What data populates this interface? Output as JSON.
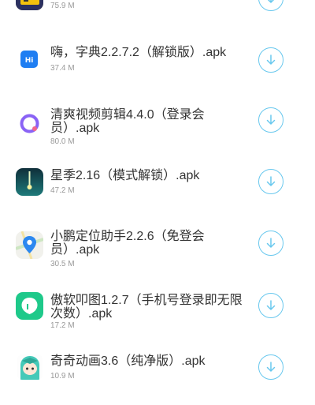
{
  "accent": "#69c8ee",
  "files": [
    {
      "name": "",
      "size": "75.9 M",
      "icon": "game-icon"
    },
    {
      "name": "嗨，字典2.2.7.2（解锁版）.apk",
      "size": "37.4 M",
      "icon": "dictionary-app-icon"
    },
    {
      "name": "清爽视频剪辑4.4.0（登录会员）.apk",
      "size": "80.0 M",
      "icon": "video-editor-app-icon"
    },
    {
      "name": "星季2.16（模式解锁）.apk",
      "size": "47.2 M",
      "icon": "starry-app-icon"
    },
    {
      "name": "小鹏定位助手2.2.6（免登会员）.apk",
      "size": "30.5 M",
      "icon": "map-pin-app-icon"
    },
    {
      "name": "傲软叩图1.2.7（手机号登录即无限次数）.apk",
      "size": "17.2 M",
      "icon": "cutout-app-icon"
    },
    {
      "name": "奇奇动画3.6（纯净版）.apk",
      "size": "10.9 M",
      "icon": "anime-app-icon"
    }
  ]
}
